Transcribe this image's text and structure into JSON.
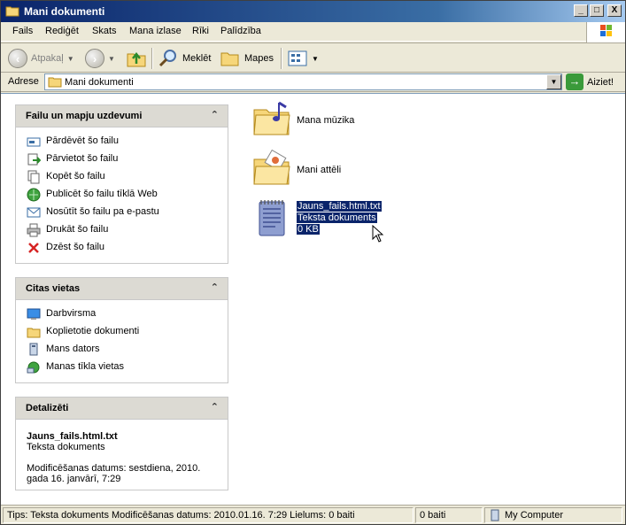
{
  "window": {
    "title": "Mani dokumenti",
    "controls": [
      "_",
      "□",
      "X"
    ]
  },
  "menu": [
    "Fails",
    "Rediģēt",
    "Skats",
    "Mana izlase",
    "Rīki",
    "Palīdzība"
  ],
  "toolbar": {
    "back_label": "Atpakaļ",
    "search_label": "Meklēt",
    "folders_label": "Mapes"
  },
  "address": {
    "label": "Adrese",
    "value": "Mani dokumenti",
    "go_label": "Aiziet!"
  },
  "panels": {
    "file_tasks": {
      "title": "Failu un mapju uzdevumi",
      "items": [
        {
          "label": "Pārdēvēt šo failu",
          "icon": "rename-icon"
        },
        {
          "label": "Pārvietot šo failu",
          "icon": "move-icon"
        },
        {
          "label": "Kopēt šo failu",
          "icon": "copy-icon"
        },
        {
          "label": "Publicēt šo failu tīklā Web",
          "icon": "publish-web-icon"
        },
        {
          "label": "Nosūtīt šo failu pa e-pastu",
          "icon": "email-icon"
        },
        {
          "label": "Drukāt šo failu",
          "icon": "print-icon"
        },
        {
          "label": "Dzēst šo failu",
          "icon": "delete-icon"
        }
      ]
    },
    "other_places": {
      "title": "Citas vietas",
      "items": [
        {
          "label": "Darbvirsma",
          "icon": "desktop-icon"
        },
        {
          "label": "Koplietotie dokumenti",
          "icon": "shared-folder-icon"
        },
        {
          "label": "Mans dators",
          "icon": "computer-icon"
        },
        {
          "label": "Manas tīkla vietas",
          "icon": "network-icon"
        }
      ]
    },
    "details": {
      "title": "Detalizēti",
      "filename": "Jauns_fails.html.txt",
      "type": "Teksta dokuments",
      "modified_line1": "Modificēšanas datums: sestdiena, 2010.",
      "modified_line2": "gada 16. janvārī, 7:29"
    }
  },
  "files": [
    {
      "name": "Mana mūzika",
      "icon": "music-folder-icon"
    },
    {
      "name": "Mani attēli",
      "icon": "pictures-folder-icon"
    },
    {
      "name": "Jauns_fails.html.txt",
      "type": "Teksta dokuments",
      "size": "0 KB",
      "icon": "text-document-icon",
      "selected": true
    }
  ],
  "statusbar": {
    "tips": "Tips: Teksta dokuments Modificēšanas datums: 2010.01.16. 7:29 Lielums: 0 baiti",
    "size": "0 baiti",
    "location": "My Computer"
  }
}
